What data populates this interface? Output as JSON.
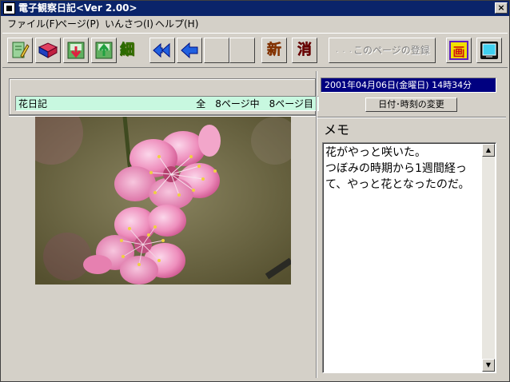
{
  "window": {
    "title": "電子観察日記<Ver 2.00>",
    "close_label": "×"
  },
  "menu": {
    "items": [
      {
        "label": "ファイル(F)"
      },
      {
        "label": "ページ(P)"
      },
      {
        "label": "いんさつ(I)"
      },
      {
        "label": "ヘルプ(H)"
      }
    ]
  },
  "toolbar": {
    "buttons": [
      {
        "name": "edit-icon"
      },
      {
        "name": "open-book-icon"
      },
      {
        "name": "import-icon"
      },
      {
        "name": "export-icon"
      },
      {
        "name": "new-diary-icon",
        "glyph": "細"
      },
      {
        "name": "first-page-icon"
      },
      {
        "name": "prev-page-icon"
      },
      {
        "name": "next-page-icon"
      },
      {
        "name": "last-page-icon"
      },
      {
        "name": "new-page-icon",
        "glyph": "新"
      },
      {
        "name": "delete-page-icon",
        "glyph": "消"
      },
      {
        "name": "screen-icon",
        "glyph": "画"
      },
      {
        "name": "fullscreen-icon"
      }
    ],
    "register_page_label": "このページの登録",
    "register_page_dots": "· · ·"
  },
  "info": {
    "diary_name": "花日記",
    "page_info": "全　8ページ中　8ページ目"
  },
  "date": {
    "text": "2001年04月06日(金曜日) 14時34分",
    "change_button": "日付･時刻の変更"
  },
  "memo": {
    "label": "メモ",
    "text": "花がやっと咲いた。\nつぼみの時期から1週間経って、やっと花となったのだ。"
  },
  "colors": {
    "titlebar": "#0a246a",
    "info_bar": "#c8f8e0",
    "date_bar": "#000080",
    "face": "#d4d0c8"
  }
}
